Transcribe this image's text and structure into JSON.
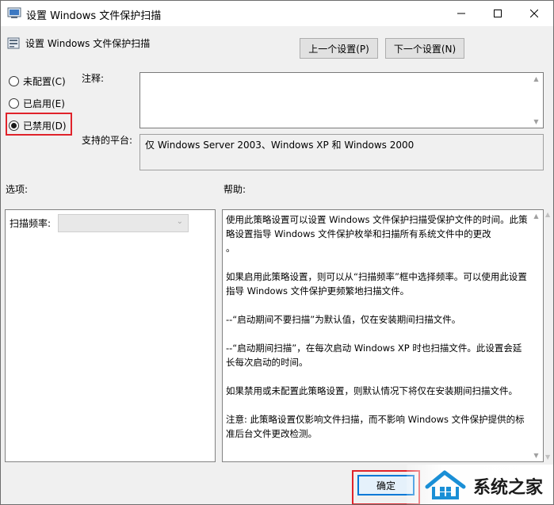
{
  "window": {
    "title": "设置 Windows 文件保护扫描",
    "controls": {
      "minimize": "minimize-icon",
      "maximize": "maximize-icon",
      "close": "close-icon"
    }
  },
  "header": {
    "title": "设置 Windows 文件保护扫描",
    "prev_label": "上一个设置(P)",
    "next_label": "下一个设置(N)"
  },
  "state": {
    "options": [
      {
        "label": "未配置(C)",
        "checked": false
      },
      {
        "label": "已启用(E)",
        "checked": false
      },
      {
        "label": "已禁用(D)",
        "checked": true
      }
    ]
  },
  "comment": {
    "label": "注释:",
    "value": ""
  },
  "platform": {
    "label": "支持的平台:",
    "value": "仅 Windows Server 2003、Windows XP 和 Windows 2000"
  },
  "options_section": {
    "label": "选项:",
    "scan_frequency_label": "扫描频率:",
    "scan_frequency_value": ""
  },
  "help_section": {
    "label": "帮助:",
    "paragraphs": [
      "使用此策略设置可以设置 Windows 文件保护扫描受保护文件的时间。此策略设置指导 Windows 文件保护枚举和扫描所有系统文件中的更改",
      "。",
      "如果启用此策略设置，则可以从“扫描频率”框中选择频率。可以使用此设置指导 Windows 文件保护更频繁地扫描文件。",
      "--“启动期间不要扫描”为默认值，仅在安装期间扫描文件。",
      "--“启动期间扫描”，在每次启动 Windows XP 时也扫描文件。此设置会延长每次启动的时间。",
      "如果禁用或未配置此策略设置，则默认情况下将仅在安装期间扫描文件。",
      "注意: 此策略设置仅影响文件扫描，而不影响 Windows 文件保护提供的标准后台文件更改检测。"
    ]
  },
  "footer": {
    "ok_label": "确定"
  },
  "watermark": {
    "text": "系统之家"
  },
  "colors": {
    "highlight": "#e0232b",
    "focus": "#0078d7"
  }
}
